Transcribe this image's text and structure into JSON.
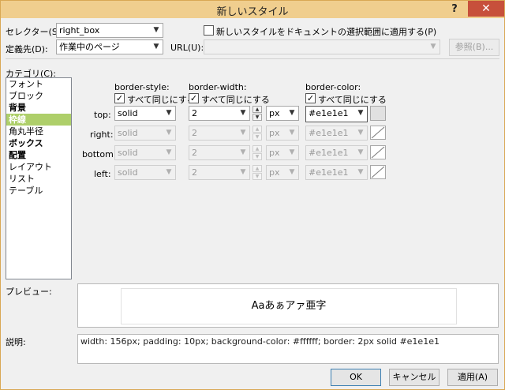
{
  "window": {
    "title": "新しいスタイル",
    "help": "?",
    "close": "✕"
  },
  "top": {
    "selector_label": "セレクター(S):",
    "selector_value": "right_box",
    "apply_checkbox_label": "新しいスタイルをドキュメントの選択範囲に適用する(P)",
    "define_label": "定義先(D):",
    "define_value": "作業中のページ",
    "url_label": "URL(U):",
    "url_value": "",
    "browse_label": "参照(B)..."
  },
  "category": {
    "label": "カテゴリ(C):",
    "items": [
      {
        "label": "フォント",
        "bold": false
      },
      {
        "label": "ブロック",
        "bold": false
      },
      {
        "label": "背景",
        "bold": true
      },
      {
        "label": "枠線",
        "bold": true,
        "selected": true
      },
      {
        "label": "角丸半径",
        "bold": false
      },
      {
        "label": "ボックス",
        "bold": true
      },
      {
        "label": "配置",
        "bold": true
      },
      {
        "label": "レイアウト",
        "bold": false
      },
      {
        "label": "リスト",
        "bold": false
      },
      {
        "label": "テーブル",
        "bold": false
      }
    ]
  },
  "border": {
    "style_header": "border-style:",
    "width_header": "border-width:",
    "color_header": "border-color:",
    "same_all_label": "すべて同じにする",
    "rows": [
      {
        "side": "top:",
        "style": "solid",
        "width": "2",
        "unit": "px",
        "color": "#e1e1e1",
        "enabled": true
      },
      {
        "side": "right:",
        "style": "solid",
        "width": "2",
        "unit": "px",
        "color": "#e1e1e1",
        "enabled": false
      },
      {
        "side": "bottom:",
        "style": "solid",
        "width": "2",
        "unit": "px",
        "color": "#e1e1e1",
        "enabled": false
      },
      {
        "side": "left:",
        "style": "solid",
        "width": "2",
        "unit": "px",
        "color": "#e1e1e1",
        "enabled": false
      }
    ]
  },
  "preview": {
    "label": "プレビュー:",
    "sample_text": "Aaあぁアァ亜字"
  },
  "description": {
    "label": "説明:",
    "text": "width: 156px; padding: 10px; background-color: #ffffff; border: 2px solid #e1e1e1"
  },
  "buttons": {
    "ok": "OK",
    "cancel": "キャンセル",
    "apply": "適用(A)"
  },
  "colors": {
    "title_bar": "#f0ce8e",
    "close_button": "#c7503b",
    "selection": "#aecf6a"
  }
}
